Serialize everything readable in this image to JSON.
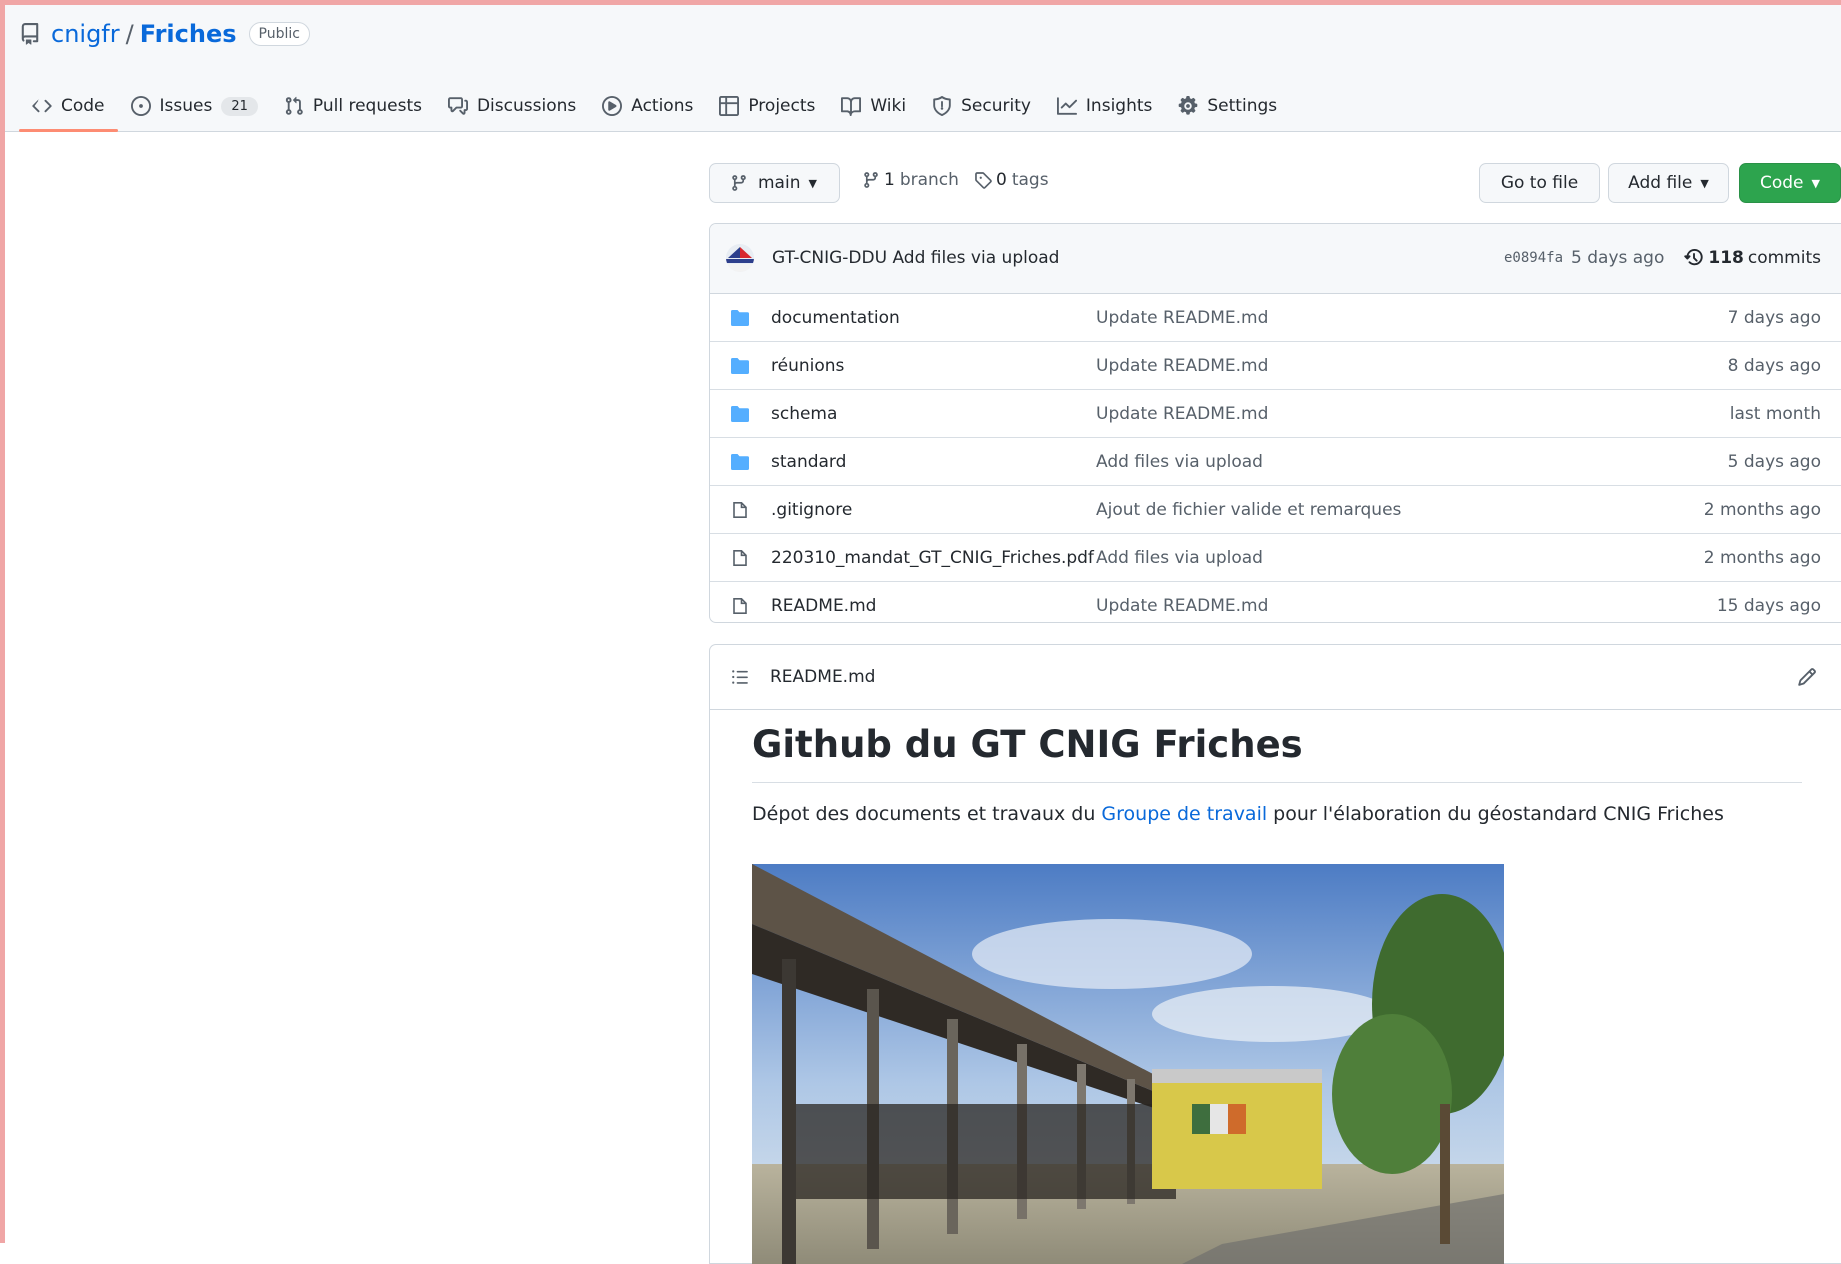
{
  "repo": {
    "owner": "cnigfr",
    "separator": "/",
    "name": "Friches",
    "visibility": "Public"
  },
  "tabs": [
    {
      "label": "Code",
      "icon": "code-icon",
      "selected": true
    },
    {
      "label": "Issues",
      "icon": "issue-opened-icon",
      "count": "21"
    },
    {
      "label": "Pull requests",
      "icon": "git-pull-request-icon"
    },
    {
      "label": "Discussions",
      "icon": "comment-discussion-icon"
    },
    {
      "label": "Actions",
      "icon": "play-icon"
    },
    {
      "label": "Projects",
      "icon": "table-icon"
    },
    {
      "label": "Wiki",
      "icon": "book-icon"
    },
    {
      "label": "Security",
      "icon": "shield-icon"
    },
    {
      "label": "Insights",
      "icon": "graph-icon"
    },
    {
      "label": "Settings",
      "icon": "gear-icon"
    }
  ],
  "toolbar": {
    "branch": "main",
    "branches_count": "1",
    "branches_label": "branch",
    "tags_count": "0",
    "tags_label": "tags",
    "go_to_file": "Go to file",
    "add_file": "Add file",
    "code": "Code"
  },
  "latest_commit": {
    "author": "GT-CNIG-DDU",
    "message": "Add files via upload",
    "sha": "e0894fa",
    "time": "5 days ago",
    "commits_count": "118",
    "commits_label": "commits"
  },
  "files": [
    {
      "type": "dir",
      "name": "documentation",
      "message": "Update README.md",
      "age": "7 days ago"
    },
    {
      "type": "dir",
      "name": "réunions",
      "message": "Update README.md",
      "age": "8 days ago"
    },
    {
      "type": "dir",
      "name": "schema",
      "message": "Update README.md",
      "age": "last month"
    },
    {
      "type": "dir",
      "name": "standard",
      "message": "Add files via upload",
      "age": "5 days ago"
    },
    {
      "type": "file",
      "name": ".gitignore",
      "message": "Ajout de fichier valide et remarques",
      "age": "2 months ago"
    },
    {
      "type": "file",
      "name": "220310_mandat_GT_CNIG_Friches.pdf",
      "message": "Add files via upload",
      "age": "2 months ago"
    },
    {
      "type": "file",
      "name": "README.md",
      "message": "Update README.md",
      "age": "15 days ago"
    }
  ],
  "readme": {
    "filename": "README.md",
    "title": "Github du GT CNIG Friches",
    "para_before": "Dépot des documents et travaux du ",
    "para_link": "Groupe de travail",
    "para_after": " pour l'élaboration du géostandard CNIG Friches"
  },
  "colors": {
    "accent": "#0969da",
    "green": "#2da44e",
    "tab_underline": "#fd8c73",
    "folder": "#54aeff"
  }
}
